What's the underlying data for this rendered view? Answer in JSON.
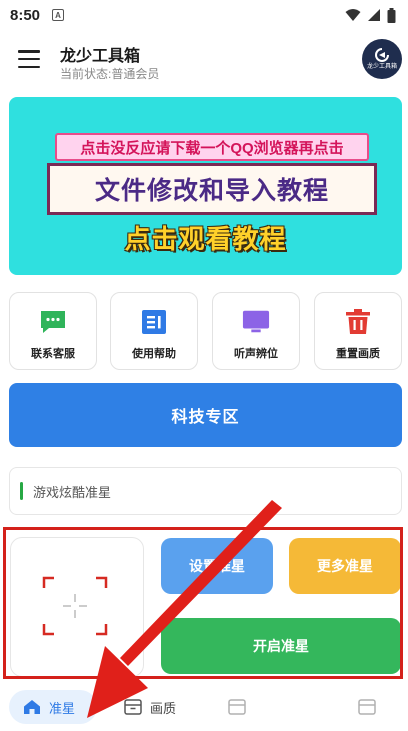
{
  "status_bar": {
    "time": "8:50",
    "app_indicator": "A",
    "icons": [
      "wifi-icon",
      "signal-icon",
      "battery-icon"
    ]
  },
  "header": {
    "title": "龙少工具箱",
    "subtitle": "当前状态:普通会员",
    "avatar_label": "龙少工具箱"
  },
  "banner": {
    "top_text": "点击没反应请下载一个QQ浏览器再点击",
    "main_text": "文件修改和导入教程",
    "sub_text": "点击观看教程"
  },
  "features": [
    {
      "label": "联系客服",
      "icon": "chat-icon"
    },
    {
      "label": "使用帮助",
      "icon": "document-icon"
    },
    {
      "label": "听声辨位",
      "icon": "monitor-icon"
    },
    {
      "label": "重置画质",
      "icon": "trash-icon"
    }
  ],
  "tech_button": {
    "label": "科技专区"
  },
  "text_card": {
    "text": "游戏炫酷准星"
  },
  "crosshair": {
    "set_label": "设置准星",
    "more_label": "更多准星",
    "start_label": "开启准星"
  },
  "bottom_nav": {
    "items": [
      {
        "label": "准星",
        "icon": "home-icon"
      },
      {
        "label": "画质",
        "icon": "box-icon"
      }
    ]
  },
  "colors": {
    "primary_blue": "#2f80e5",
    "highlight_red": "#d4211b",
    "banner_cyan": "#2fe0df",
    "green": "#34b75c",
    "orange": "#f5b937"
  }
}
